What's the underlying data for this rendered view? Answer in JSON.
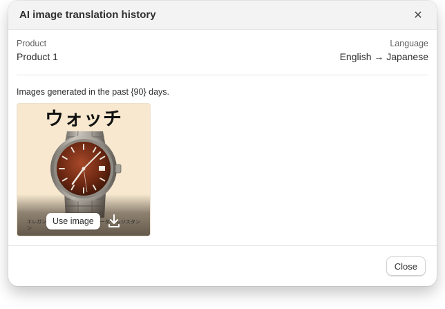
{
  "dialog": {
    "title": "AI image translation history",
    "close_icon": "close-icon"
  },
  "info": {
    "product_label": "Product",
    "product_value": "Product 1",
    "language_label": "Language",
    "language_value": "English → Japanese"
  },
  "gallery": {
    "caption": "Images generated in the past {90} days.",
    "images": [
      {
        "title_text": "ウォッチ",
        "tags": [
          "エレガント デザイン",
          "ステンレス",
          "ウォーター レジスタント"
        ],
        "use_label": "Use image",
        "download_icon": "download-icon"
      }
    ]
  },
  "footer": {
    "close_label": "Close"
  },
  "colors": {
    "header_bg": "#f3f3f3",
    "thumb_bg": "#f7e8cf",
    "dial": "#7a2e16"
  }
}
